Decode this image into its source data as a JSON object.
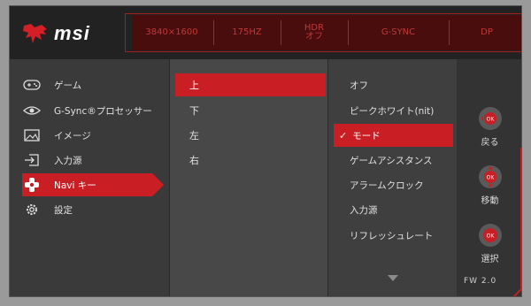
{
  "header": {
    "brand": "msi",
    "status": {
      "resolution": "3840×1600",
      "refresh": "175HZ",
      "hdr_line1": "HDR",
      "hdr_line2": "オフ",
      "sync": "G-SYNC",
      "input": "DP"
    }
  },
  "left_menu": {
    "items": [
      {
        "label": "ゲーム",
        "icon": "gamepad-icon"
      },
      {
        "label": "G-Sync®プロセッサー",
        "icon": "eye-icon"
      },
      {
        "label": "イメージ",
        "icon": "image-icon"
      },
      {
        "label": "入力源",
        "icon": "input-icon"
      },
      {
        "label": "Navi キー",
        "icon": "navi-key-icon"
      },
      {
        "label": "設定",
        "icon": "gear-icon"
      }
    ],
    "active_index": 4
  },
  "sub_menu": {
    "items": [
      "上",
      "下",
      "左",
      "右"
    ],
    "active_index": 0
  },
  "options": {
    "items": [
      "オフ",
      "ピークホワイト(nit)",
      "モード",
      "ゲームアシスタンス",
      "アラームクロック",
      "入力源",
      "リフレッシュレート"
    ],
    "active_index": 2,
    "check": "✓"
  },
  "controls": {
    "back_label": "戻る",
    "move_label": "移動",
    "select_label": "選択",
    "ok_text": "OK",
    "firmware": "FW 2.0"
  },
  "colors": {
    "accent": "#c81e24",
    "header_strip": "#4a0d0d",
    "status_text": "#c23838"
  }
}
